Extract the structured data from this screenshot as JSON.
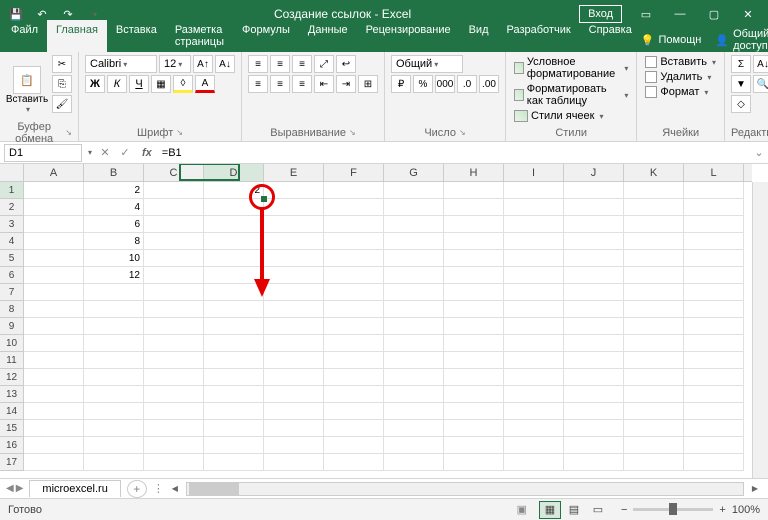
{
  "titlebar": {
    "title": "Создание ссылок - Excel",
    "login": "Вход"
  },
  "tabs": {
    "items": [
      "Файл",
      "Главная",
      "Вставка",
      "Разметка страницы",
      "Формулы",
      "Данные",
      "Рецензирование",
      "Вид",
      "Разработчик",
      "Справка"
    ],
    "active": 1,
    "help": "Помощн",
    "share": "Общий доступ"
  },
  "ribbon": {
    "clipboard": {
      "label": "Буфер обмена",
      "paste": "Вставить"
    },
    "font": {
      "label": "Шрифт",
      "family": "Calibri",
      "size": "12"
    },
    "align": {
      "label": "Выравнивание"
    },
    "number": {
      "label": "Число",
      "format": "Общий"
    },
    "styles": {
      "label": "Стили",
      "cond": "Условное форматирование",
      "table": "Форматировать как таблицу",
      "cell": "Стили ячеек"
    },
    "cells": {
      "label": "Ячейки",
      "insert": "Вставить",
      "delete": "Удалить",
      "format": "Формат"
    },
    "editing": {
      "label": "Редактирование"
    }
  },
  "namebox": "D1",
  "formula": "=B1",
  "columns": [
    "A",
    "B",
    "C",
    "D",
    "E",
    "F",
    "G",
    "H",
    "I",
    "J",
    "K",
    "L"
  ],
  "rows": [
    "1",
    "2",
    "3",
    "4",
    "5",
    "6",
    "7",
    "8",
    "9",
    "10",
    "11",
    "12",
    "13",
    "14",
    "15",
    "16",
    "17"
  ],
  "data_b": [
    "2",
    "4",
    "6",
    "8",
    "10",
    "12"
  ],
  "data_d1": "2",
  "active": {
    "col": 3,
    "row": 0
  },
  "sheet": {
    "name": "microexcel.ru"
  },
  "status": {
    "ready": "Готово",
    "zoom": "100%"
  }
}
